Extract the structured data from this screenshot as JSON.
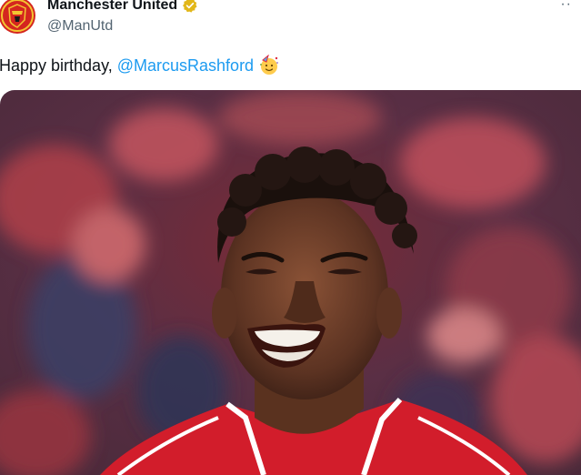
{
  "account": {
    "display_name": "Manchester United",
    "handle": "@ManUtd",
    "verified": true,
    "avatar_icon": "club-crest-icon",
    "badge_color": "#e2b719"
  },
  "tweet": {
    "text_prefix": "Happy birthday, ",
    "mention": "@MarcusRashford",
    "emoji_icon": "partying-face-emoji",
    "mention_color": "#1d9bf0"
  },
  "menu": {
    "more_label": "··"
  },
  "media": {
    "image_icon": "player-smiling-photo"
  }
}
